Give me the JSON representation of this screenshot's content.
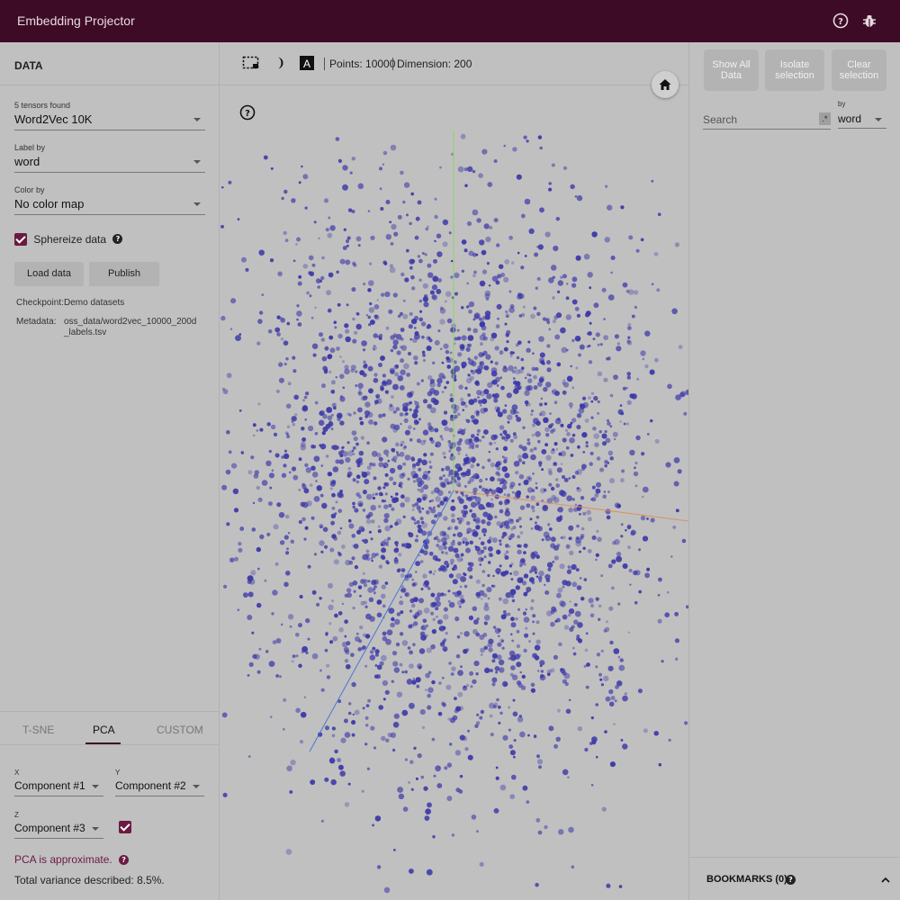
{
  "app": {
    "title": "Embedding Projector"
  },
  "left": {
    "header": "DATA",
    "tensors": {
      "label": "5 tensors found",
      "value": "Word2Vec 10K"
    },
    "label_by": {
      "label": "Label by",
      "value": "word"
    },
    "color_by": {
      "label": "Color by",
      "value": "No color map"
    },
    "sphereize": {
      "label": "Sphereize data",
      "checked": true
    },
    "load_btn": "Load data",
    "publish_btn": "Publish",
    "checkpoint": {
      "key": "Checkpoint:",
      "value": "Demo datasets"
    },
    "metadata": {
      "key": "Metadata:",
      "value": "oss_data/word2vec_10000_200d_labels.tsv"
    }
  },
  "tabs": [
    "T-SNE",
    "PCA",
    "CUSTOM"
  ],
  "active_tab": "PCA",
  "pca": {
    "x": {
      "label": "X",
      "value": "Component #1"
    },
    "y": {
      "label": "Y",
      "value": "Component #2"
    },
    "z": {
      "label": "Z",
      "value": "Component #3",
      "checked": true
    },
    "approx": "PCA is approximate.",
    "variance": "Total variance described: 8.5%."
  },
  "toolbar": {
    "points": "Points: 10000",
    "dimension": "Dimension: 200"
  },
  "right": {
    "show_all": "Show All Data",
    "isolate": "Isolate selection",
    "clear": "Clear selection",
    "search_placeholder": "Search",
    "regex": ".*",
    "by_label": "by",
    "by_value": "word",
    "bookmarks": "BOOKMARKS (0)"
  },
  "colors": {
    "topbar": "#3e0b26",
    "accent": "#6b1a42",
    "point": "#3c38a8",
    "axis_x": "#e08a5a",
    "axis_y": "#8bd45a",
    "axis_z": "#3a6fd8"
  },
  "icons": [
    "help-icon",
    "bug-icon",
    "rect-select-icon",
    "night-mode-icon",
    "label-icon",
    "home-icon",
    "plot-help-icon",
    "chevron-up-icon"
  ]
}
